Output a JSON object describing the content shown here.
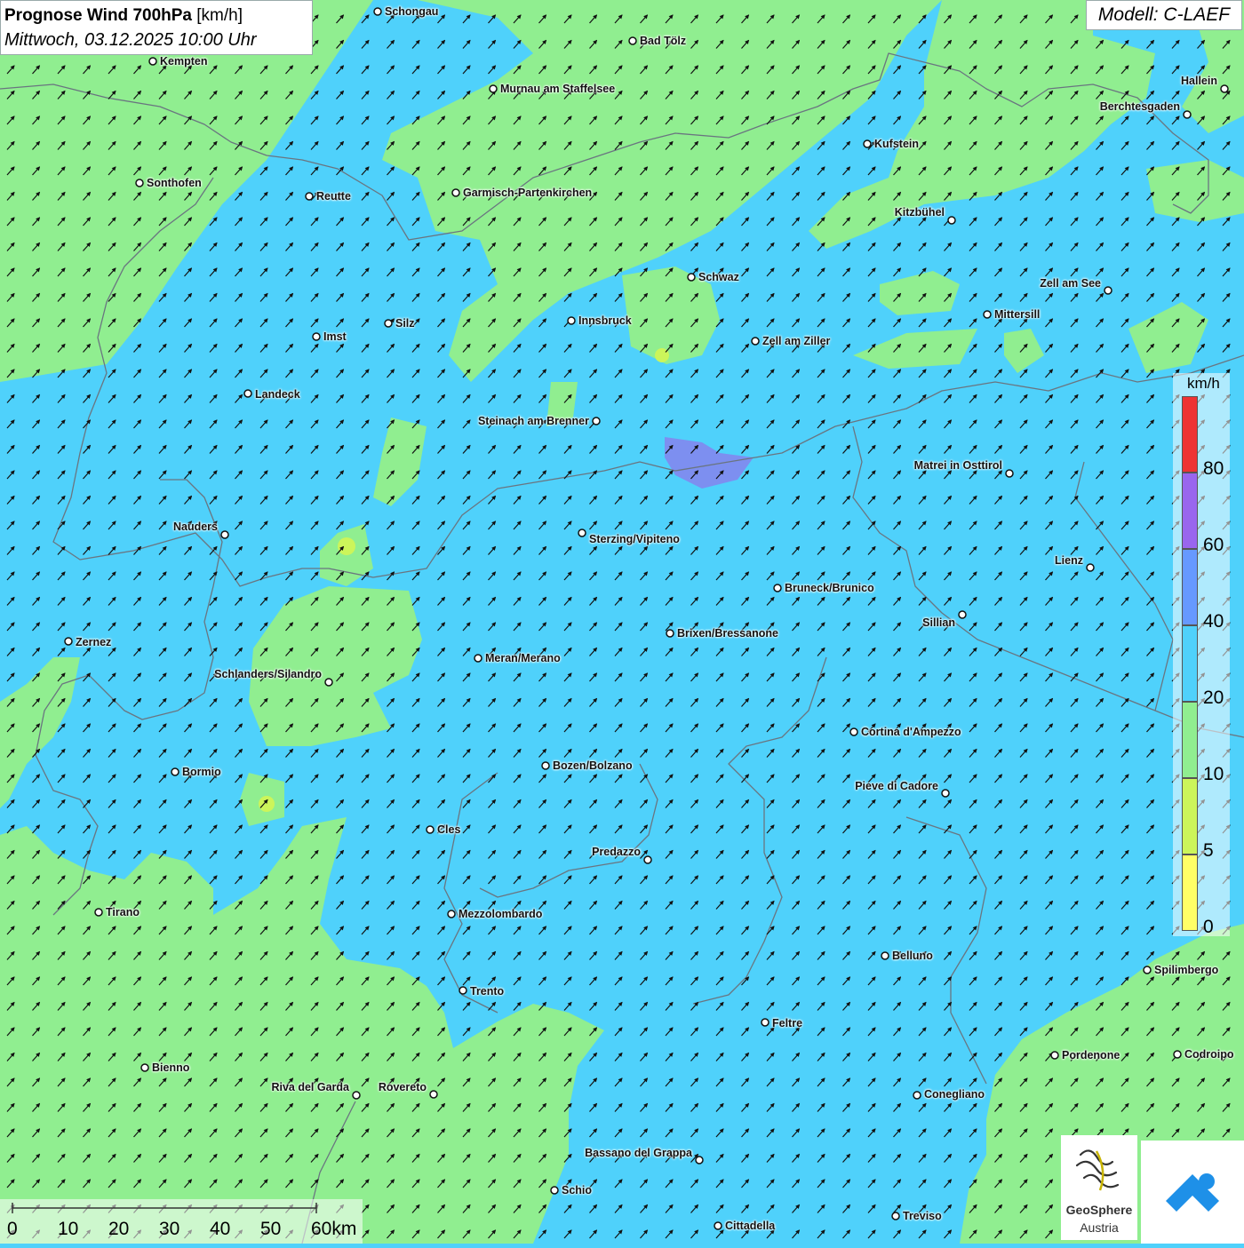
{
  "header": {
    "title_bold": "Prognose Wind 700hPa",
    "title_unit": "[km/h]",
    "subtitle": "Mittwoch, 03.12.2025 10:00 Uhr"
  },
  "model_label": "Modell: C-LAEF",
  "legend": {
    "unit": "km/h",
    "classes": [
      {
        "from": 0,
        "to": 5,
        "color": "#ffff66"
      },
      {
        "from": 5,
        "to": 10,
        "color": "#ccf55a"
      },
      {
        "from": 10,
        "to": 20,
        "color": "#90ee90"
      },
      {
        "from": 20,
        "to": 40,
        "color": "#4fd1fb"
      },
      {
        "from": 40,
        "to": 60,
        "color": "#6699ff"
      },
      {
        "from": 60,
        "to": 80,
        "color": "#9966ee"
      },
      {
        "from": 80,
        "to": 100,
        "color": "#ee3333"
      }
    ],
    "labels": [
      "0",
      "5",
      "10",
      "20",
      "40",
      "60",
      "80"
    ]
  },
  "scale_bar": {
    "labels": [
      "0",
      "10",
      "20",
      "30",
      "40",
      "50",
      "60km"
    ]
  },
  "cities": [
    {
      "name": "Schongau"
    },
    {
      "name": "Bad Tölz"
    },
    {
      "name": "Kempten"
    },
    {
      "name": "Murnau am Staffelsee"
    },
    {
      "name": "Hallein"
    },
    {
      "name": "Berchtesgaden"
    },
    {
      "name": "Kufstein"
    },
    {
      "name": "Sonthofen"
    },
    {
      "name": "Reutte"
    },
    {
      "name": "Garmisch-Partenkirchen"
    },
    {
      "name": "Kitzbühel"
    },
    {
      "name": "Schwaz"
    },
    {
      "name": "Zell am See"
    },
    {
      "name": "Innsbruck"
    },
    {
      "name": "Mittersill"
    },
    {
      "name": "Imst"
    },
    {
      "name": "Silz"
    },
    {
      "name": "Zell am Ziller"
    },
    {
      "name": "Landeck"
    },
    {
      "name": "Steinach am Brenner"
    },
    {
      "name": "Matrei in Osttirol"
    },
    {
      "name": "Nauders"
    },
    {
      "name": "Sterzing/Vipiteno"
    },
    {
      "name": "Lienz"
    },
    {
      "name": "Bruneck/Brunico"
    },
    {
      "name": "Sillian"
    },
    {
      "name": "Zernez"
    },
    {
      "name": "Brixen/Bressanone"
    },
    {
      "name": "Meran/Merano"
    },
    {
      "name": "Schlanders/Silandro"
    },
    {
      "name": "Cortina d'Ampezzo"
    },
    {
      "name": "Bozen/Bolzano"
    },
    {
      "name": "Bormio"
    },
    {
      "name": "Pieve di Cadore"
    },
    {
      "name": "Cles"
    },
    {
      "name": "Predazzo"
    },
    {
      "name": "Tirano"
    },
    {
      "name": "Mezzolombardo"
    },
    {
      "name": "Belluno"
    },
    {
      "name": "Spilimbergo"
    },
    {
      "name": "Trento"
    },
    {
      "name": "Feltre"
    },
    {
      "name": "Pordenone"
    },
    {
      "name": "Codroipo"
    },
    {
      "name": "Bienno"
    },
    {
      "name": "Riva del Garda"
    },
    {
      "name": "Rovereto"
    },
    {
      "name": "Conegliano"
    },
    {
      "name": "Bassano del Grappa"
    },
    {
      "name": "Schio"
    },
    {
      "name": "Treviso"
    },
    {
      "name": "Cittadella"
    }
  ],
  "wind_direction": "southwest",
  "logos": {
    "geosphere_line1": "GeoSphere",
    "geosphere_line2": "Austria"
  }
}
